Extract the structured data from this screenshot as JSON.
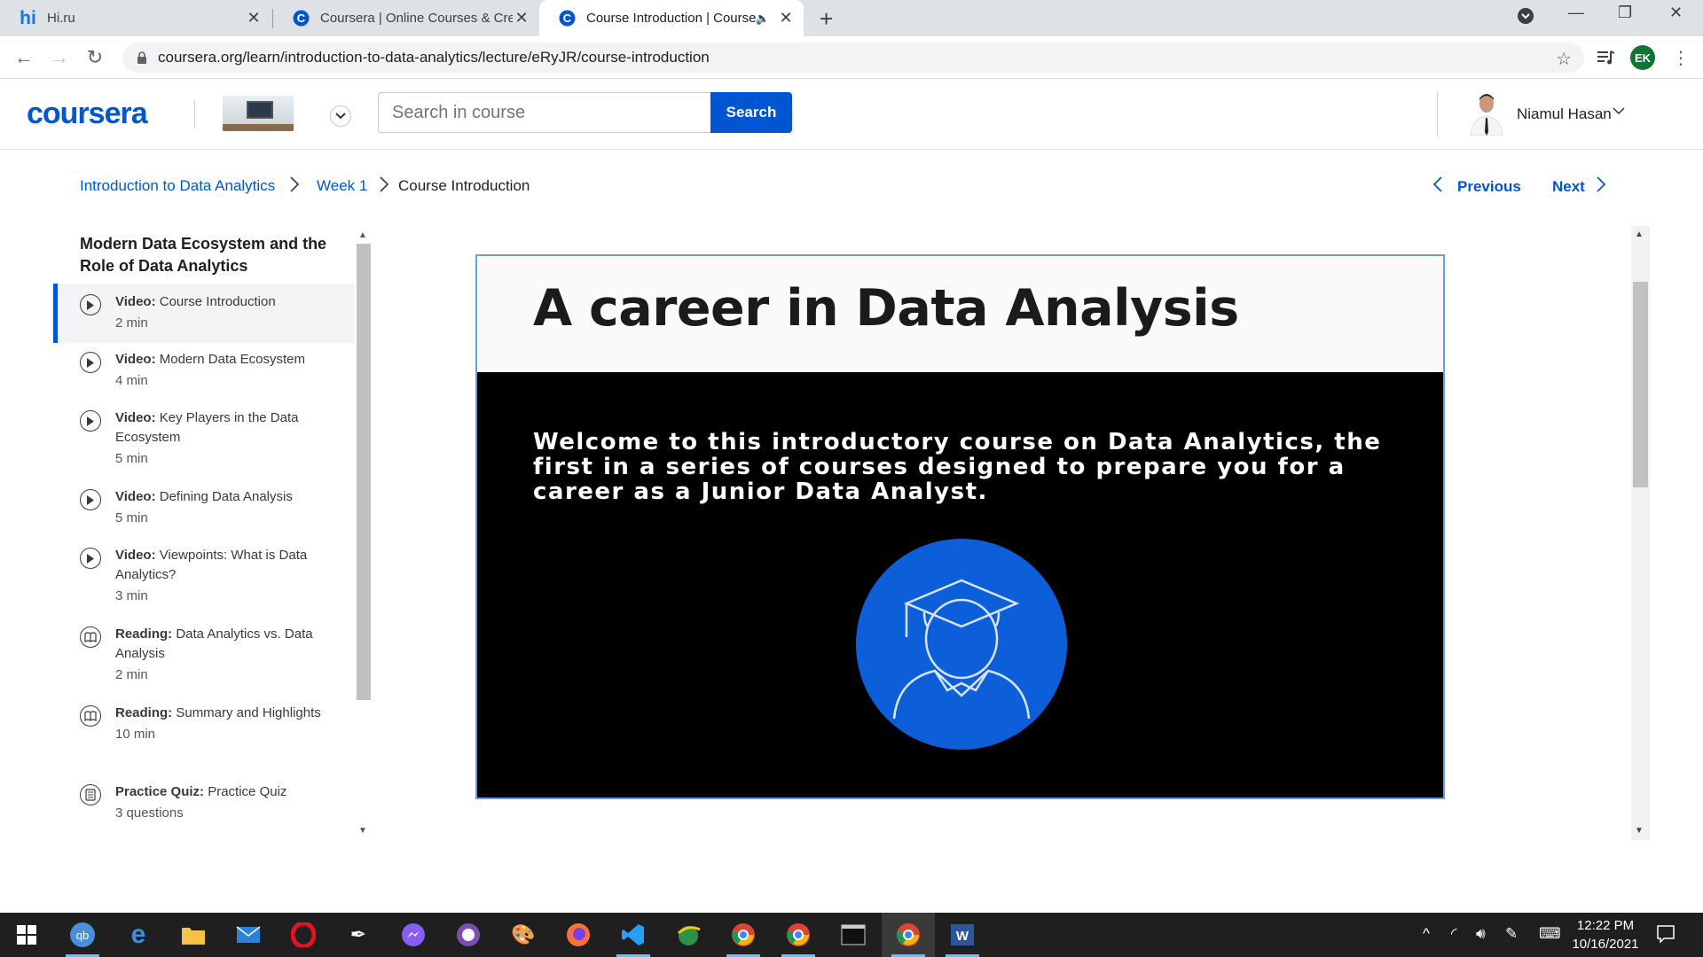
{
  "browser": {
    "tabs": [
      {
        "title": "Hi.ru",
        "active": false
      },
      {
        "title": "Coursera | Online Courses & Crec",
        "active": false
      },
      {
        "title": "Course Introduction | Course",
        "active": true
      }
    ],
    "url": "coursera.org/learn/introduction-to-data-analytics/lecture/eRyJR/course-introduction",
    "profile_initials": "EK"
  },
  "header": {
    "logo": "coursera",
    "search_placeholder": "Search in course",
    "search_button": "Search",
    "user_name": "Niamul Hasan"
  },
  "breadcrumb": {
    "course": "Introduction to Data Analytics",
    "week": "Week 1",
    "current": "Course Introduction",
    "previous": "Previous",
    "next": "Next"
  },
  "sidebar": {
    "module_title": "Modern Data Ecosystem and the Role of Data Analytics",
    "items": [
      {
        "type": "Video:",
        "title": "Course Introduction",
        "meta": "2 min",
        "icon": "play-icon"
      },
      {
        "type": "Video:",
        "title": "Modern Data Ecosystem",
        "meta": "4 min",
        "icon": "play-icon"
      },
      {
        "type": "Video:",
        "title": "Key Players in the Data Ecosystem",
        "meta": "5 min",
        "icon": "play-icon"
      },
      {
        "type": "Video:",
        "title": "Defining Data Analysis",
        "meta": "5 min",
        "icon": "play-icon"
      },
      {
        "type": "Video:",
        "title": "Viewpoints: What is Data Analytics?",
        "meta": "3 min",
        "icon": "play-icon"
      },
      {
        "type": "Reading:",
        "title": "Data Analytics vs. Data Analysis",
        "meta": "2 min",
        "icon": "reading-icon"
      },
      {
        "type": "Reading:",
        "title": "Summary and Highlights",
        "meta": "10 min",
        "icon": "reading-icon"
      },
      {
        "type": "Practice Quiz:",
        "title": "Practice Quiz",
        "meta": "3 questions",
        "icon": "quiz-icon"
      }
    ]
  },
  "slide": {
    "heading": "A career in Data Analysis",
    "body": "Welcome to this introductory course on Data Analytics, the first in a series of courses designed to prepare you for a career as a Junior Data Analyst."
  },
  "taskbar": {
    "time": "12:22 PM",
    "date": "10/16/2021"
  }
}
